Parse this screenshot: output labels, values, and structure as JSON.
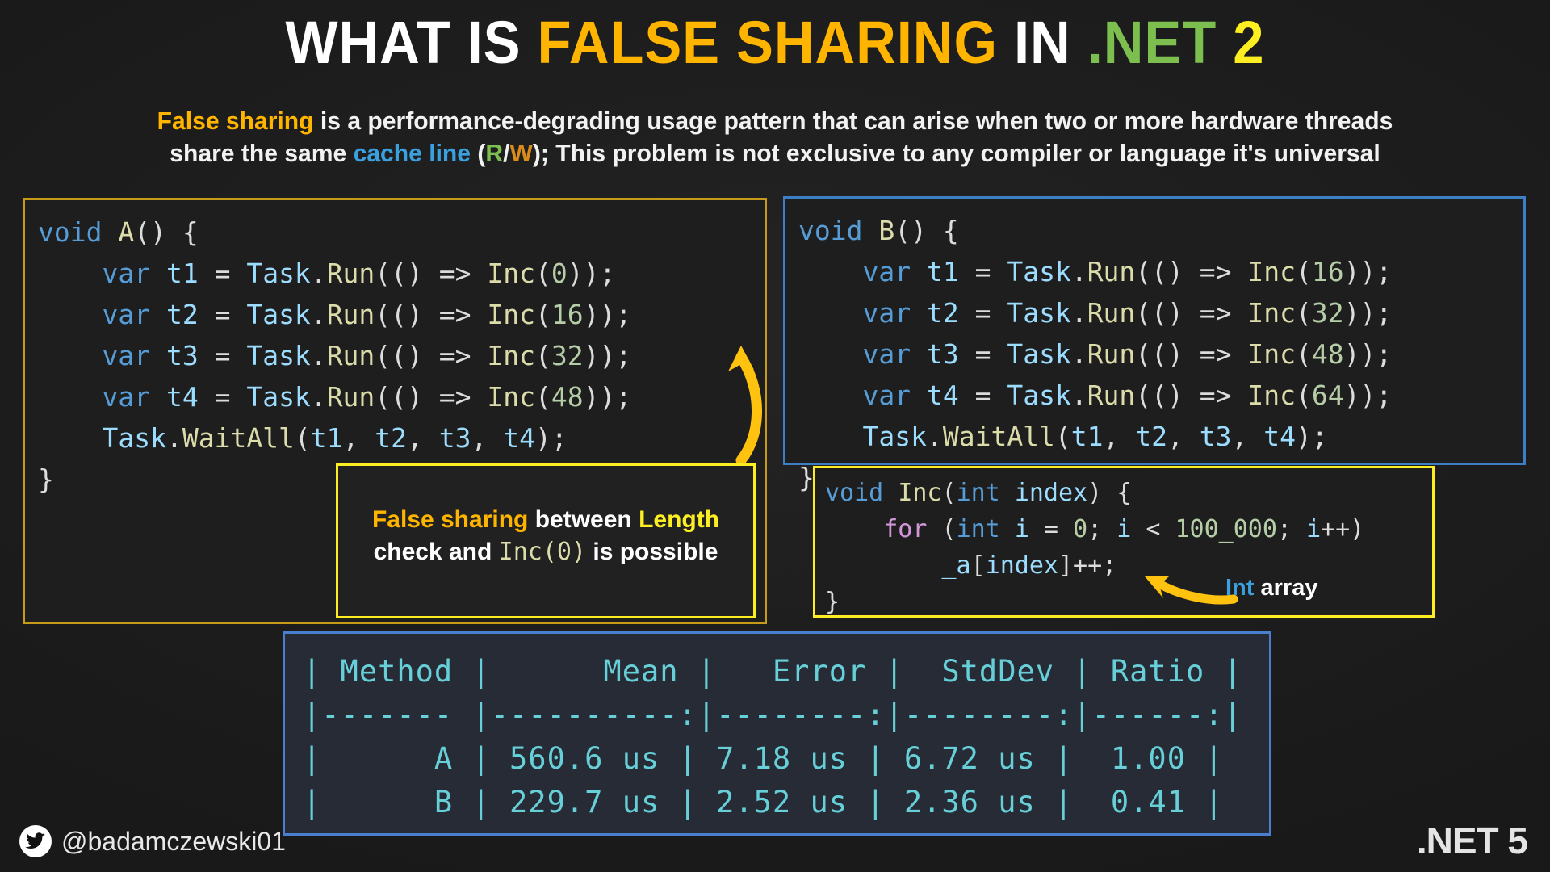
{
  "title": {
    "part1": "WHAT IS ",
    "part2": "FALSE SHARING",
    "part3": " IN ",
    "part4": ".NET",
    "part5": " 2"
  },
  "subtitle": {
    "l1_a": "False sharing",
    "l1_b": " is a performance-degrading usage pattern that can arise when two or more hardware threads",
    "l2_a": "share the same ",
    "l2_b": "cache line",
    "l2_c": " (",
    "l2_r": "R",
    "l2_slash": "/",
    "l2_w": "W",
    "l2_d": "); This problem is not exclusive to any compiler or language it's universal"
  },
  "code_a": {
    "lines": [
      "void A() {",
      "    var t1 = Task.Run(() => Inc(0));",
      "    var t2 = Task.Run(() => Inc(16));",
      "    var t3 = Task.Run(() => Inc(32));",
      "    var t4 = Task.Run(() => Inc(48));",
      "    Task.WaitAll(t1, t2, t3, t4);",
      "}"
    ]
  },
  "code_b": {
    "lines": [
      "void B() {",
      "    var t1 = Task.Run(() => Inc(16));",
      "    var t2 = Task.Run(() => Inc(32));",
      "    var t3 = Task.Run(() => Inc(48));",
      "    var t4 = Task.Run(() => Inc(64));",
      "    Task.WaitAll(t1, t2, t3, t4);",
      "}"
    ]
  },
  "code_inc": {
    "lines": [
      "void Inc(int index) {",
      "    for (int i = 0; i < 100_000; i++)",
      "        _a[index]++;",
      "}"
    ]
  },
  "note": {
    "w1": "False sharing",
    "w2": " between ",
    "w3": "Length",
    "w4": " check and ",
    "w5_code": "Inc(0)",
    "w6": " is possible"
  },
  "int_array_label": {
    "type": "Int",
    "word": " array"
  },
  "benchmark": {
    "headers": [
      "Method",
      "Mean",
      "Error",
      "StdDev",
      "Ratio"
    ],
    "separator": "|------- |----------:|--------:|--------:|------:|",
    "header_row": "| Method |      Mean |   Error |  StdDev | Ratio |",
    "rows": [
      {
        "method": "A",
        "mean": "560.6 us",
        "error": "7.18 us",
        "stddev": "6.72 us",
        "ratio": "1.00",
        "raw": "|      A | 560.6 us | 7.18 us | 6.72 us |  1.00 |"
      },
      {
        "method": "B",
        "mean": "229.7 us",
        "error": "2.52 us",
        "stddev": "2.36 us",
        "ratio": "0.41",
        "raw": "|      B | 229.7 us | 2.52 us | 2.36 us |  0.41 |"
      }
    ]
  },
  "footer": {
    "handle": "@badamczewski01",
    "version": ".NET 5",
    "twitter_icon": "twitter-bird-icon"
  },
  "colors": {
    "accent_amber": "#ffb400",
    "accent_yellow": "#fcee21",
    "accent_green": "#7cbf4f",
    "accent_blue": "#3aa0e0",
    "panel_a_border": "#c79a18",
    "panel_b_border": "#3c7fc4",
    "table_border": "#4a7fd0",
    "table_text": "#66cfd8",
    "background": "#1f1f1f"
  }
}
